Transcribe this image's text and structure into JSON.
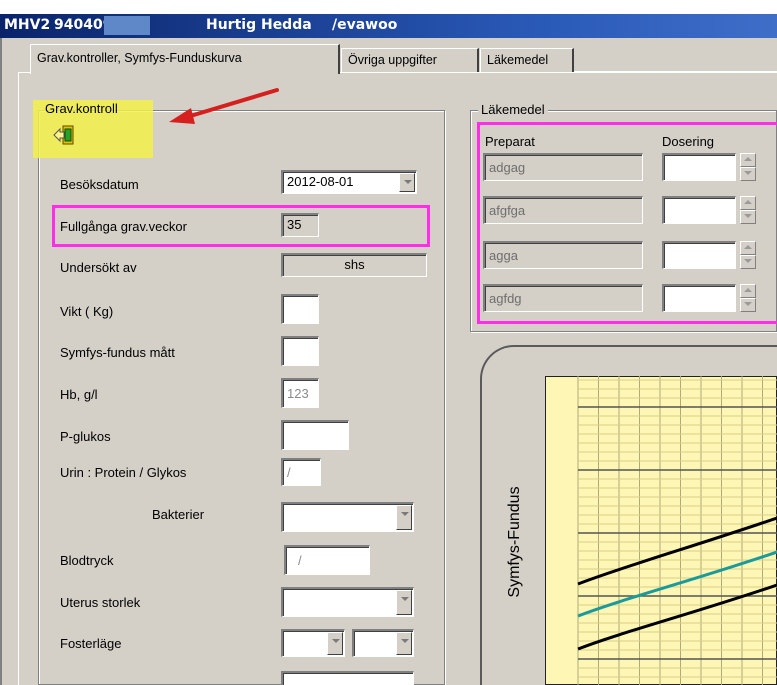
{
  "title_bar": {
    "app_code": "MHV2",
    "patient_id": "940409-",
    "patient_name": "Hurtig Hedda",
    "user": "/evawoo"
  },
  "tabs": [
    {
      "label": "Grav.kontroller, Symfys-Funduskurva",
      "active": true
    },
    {
      "label": "Övriga uppgifter",
      "active": false
    },
    {
      "label": "Läkemedel",
      "active": false
    }
  ],
  "grav_kontroll": {
    "legend": "Grav.kontroll",
    "icon": "exit-door-arrow-icon",
    "fields": {
      "besoksdatum": {
        "label": "Besöksdatum",
        "value": "2012-08-01"
      },
      "fullganga": {
        "label": "Fullgånga grav.veckor",
        "value": "35"
      },
      "undersokt_av": {
        "label": "Undersökt av",
        "value": "shs"
      },
      "vikt": {
        "label": "Vikt ( Kg)",
        "value": ""
      },
      "symfys": {
        "label": "Symfys-fundus mått",
        "value": ""
      },
      "hb": {
        "label": "Hb, g/l",
        "value": "123"
      },
      "p_glukos": {
        "label": "P-glukos",
        "value": ""
      },
      "urin": {
        "label": "Urin :  Protein / Glykos",
        "value": "/"
      },
      "bakterier": {
        "label": "Bakterier",
        "value": ""
      },
      "blodtryck": {
        "label": "Blodtryck",
        "value": "/"
      },
      "uterus": {
        "label": "Uterus storlek",
        "value": ""
      },
      "fosterlage": {
        "label": "Fosterläge",
        "value": ""
      }
    }
  },
  "lakemedel": {
    "legend": "Läkemedel",
    "col_preparat": "Preparat",
    "col_dosering": "Dosering",
    "rows": [
      {
        "preparat": "adgag",
        "dosering": ""
      },
      {
        "preparat": "afgfga",
        "dosering": ""
      },
      {
        "preparat": "agga",
        "dosering": ""
      },
      {
        "preparat": "agfdg",
        "dosering": ""
      }
    ]
  },
  "chart": {
    "ylabel": "Symfys-Fundus"
  },
  "colors": {
    "highlight_yellow": "#f2f04a",
    "highlight_pink": "#ff2de6",
    "arrow_red": "#d61f1f",
    "chart_bg": "#fdf6b4",
    "curve_teal": "#1a9a9a"
  }
}
